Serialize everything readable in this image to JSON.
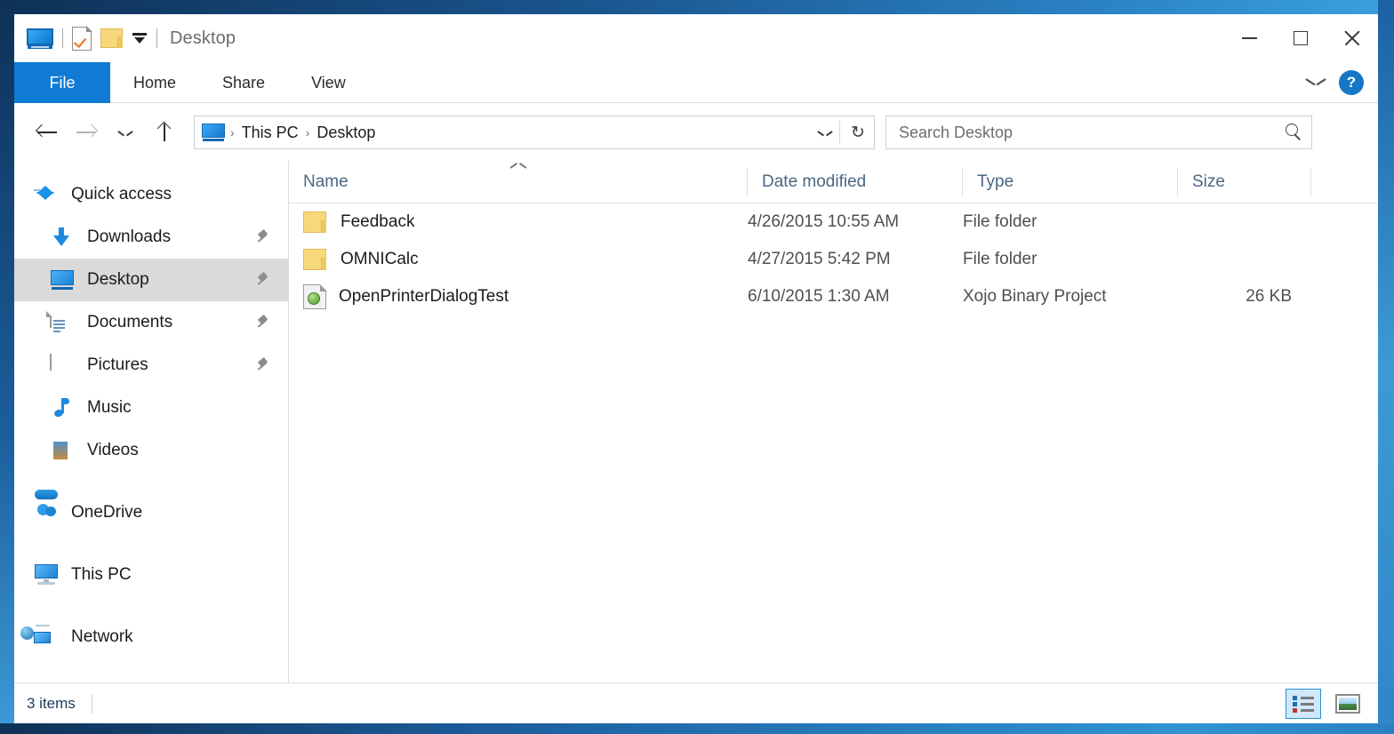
{
  "window": {
    "title": "Desktop",
    "accent_color": "#0f7bd4",
    "frame_color": "#0e3157"
  },
  "quick_access_toolbar": {
    "items": [
      {
        "name": "explorer-icon",
        "label": "File Explorer"
      },
      {
        "name": "properties-icon",
        "label": "Properties"
      },
      {
        "name": "new-folder-icon",
        "label": "New folder"
      },
      {
        "name": "customize-dropdown-icon",
        "label": "Customize Quick Access Toolbar"
      }
    ]
  },
  "window_controls": {
    "minimize": "Minimize",
    "maximize": "Maximize",
    "close": "Close"
  },
  "ribbon": {
    "tabs": [
      {
        "label": "File",
        "active": true
      },
      {
        "label": "Home",
        "active": false
      },
      {
        "label": "Share",
        "active": false
      },
      {
        "label": "View",
        "active": false
      }
    ],
    "collapse_label": "Minimize the Ribbon",
    "help_label": "?"
  },
  "navigation": {
    "back_label": "Back",
    "forward_label": "Forward",
    "recent_label": "Recent locations",
    "up_label": "Up to This PC",
    "breadcrumbs": [
      {
        "label": "This PC"
      },
      {
        "label": "Desktop"
      }
    ],
    "separator": "›",
    "dropdown_label": "Previous locations",
    "refresh_label": "↻"
  },
  "search": {
    "placeholder": "Search Desktop",
    "icon": "search-icon"
  },
  "sidebar": {
    "groups": [
      {
        "name": "quick-access",
        "header": {
          "label": "Quick access",
          "icon": "star-icon"
        },
        "items": [
          {
            "label": "Downloads",
            "icon": "download-icon",
            "pinned": true,
            "selected": false
          },
          {
            "label": "Desktop",
            "icon": "monitor-icon",
            "pinned": true,
            "selected": true
          },
          {
            "label": "Documents",
            "icon": "document-icon",
            "pinned": true,
            "selected": false
          },
          {
            "label": "Pictures",
            "icon": "picture-icon",
            "pinned": true,
            "selected": false
          },
          {
            "label": "Music",
            "icon": "music-icon",
            "pinned": false,
            "selected": false
          },
          {
            "label": "Videos",
            "icon": "video-icon",
            "pinned": false,
            "selected": false
          }
        ]
      },
      {
        "name": "roots",
        "items": [
          {
            "label": "OneDrive",
            "icon": "cloud-icon"
          },
          {
            "label": "This PC",
            "icon": "this-pc-icon"
          },
          {
            "label": "Network",
            "icon": "network-icon"
          }
        ]
      }
    ]
  },
  "file_list": {
    "columns": [
      {
        "key": "name",
        "label": "Name",
        "sorted": "asc"
      },
      {
        "key": "date",
        "label": "Date modified",
        "sorted": ""
      },
      {
        "key": "type",
        "label": "Type",
        "sorted": ""
      },
      {
        "key": "size",
        "label": "Size",
        "sorted": ""
      }
    ],
    "rows": [
      {
        "name": "Feedback",
        "date": "4/26/2015 10:55 AM",
        "type": "File folder",
        "size": "",
        "icon": "folder-icon"
      },
      {
        "name": "OMNICalc",
        "date": "4/27/2015 5:42 PM",
        "type": "File folder",
        "size": "",
        "icon": "folder-icon"
      },
      {
        "name": "OpenPrinterDialogTest",
        "date": "6/10/2015 1:30 AM",
        "type": "Xojo Binary Project",
        "size": "26 KB",
        "icon": "xojo-project-icon"
      }
    ]
  },
  "status_bar": {
    "item_count": "3 items",
    "views": [
      {
        "name": "details-view",
        "label": "Details view",
        "active": true
      },
      {
        "name": "large-icons-view",
        "label": "Large icons view",
        "active": false
      }
    ]
  }
}
